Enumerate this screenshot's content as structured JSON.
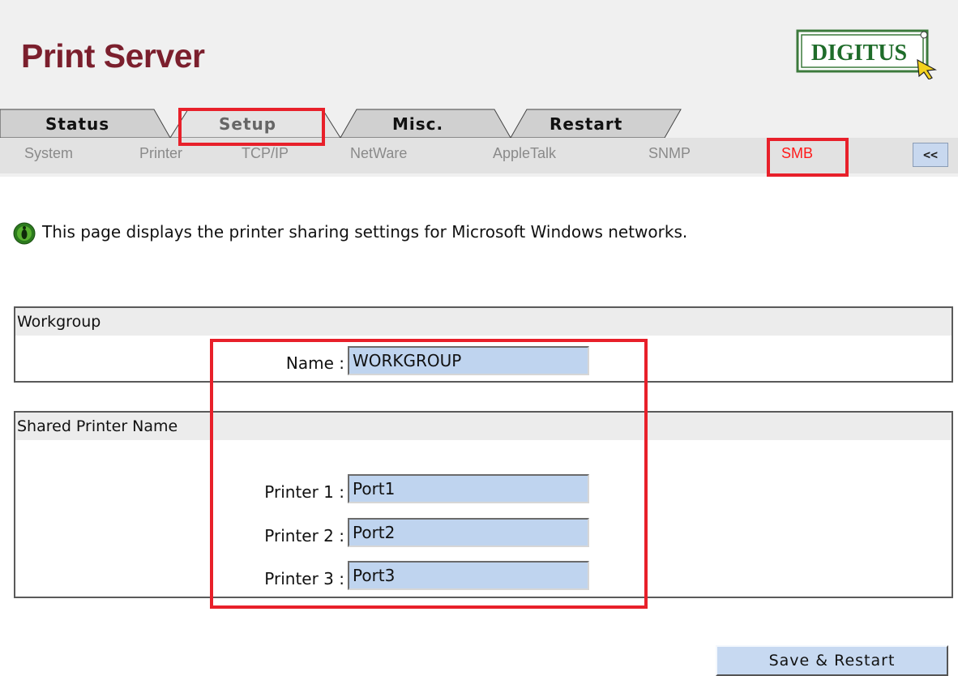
{
  "header": {
    "title": "Print Server",
    "logo_text": "DIGITUS"
  },
  "tabs": [
    {
      "label": "Status"
    },
    {
      "label": "Setup"
    },
    {
      "label": "Misc."
    },
    {
      "label": "Restart"
    }
  ],
  "subnav": {
    "items": [
      {
        "label": "System"
      },
      {
        "label": "Printer"
      },
      {
        "label": "TCP/IP"
      },
      {
        "label": "NetWare"
      },
      {
        "label": "AppleTalk"
      },
      {
        "label": "SNMP"
      },
      {
        "label": "SMB"
      }
    ],
    "active": "SMB",
    "collapse_label": "<<"
  },
  "info": {
    "text": "This page displays the printer sharing settings for Microsoft Windows networks."
  },
  "workgroup": {
    "title": "Workgroup",
    "name_label": "Name :",
    "name_value": "WORKGROUP"
  },
  "shared_printers": {
    "title": "Shared Printer Name",
    "printers": [
      {
        "label": "Printer 1 :",
        "value": "Port1"
      },
      {
        "label": "Printer 2 :",
        "value": "Port2"
      },
      {
        "label": "Printer 3 :",
        "value": "Port3"
      }
    ]
  },
  "actions": {
    "save_label": "Save & Restart"
  },
  "colors": {
    "title": "#7b1f2d",
    "highlight": "#e8202a",
    "input_bg": "#bfd4ef",
    "active_subnav": "#ff1a1a"
  }
}
